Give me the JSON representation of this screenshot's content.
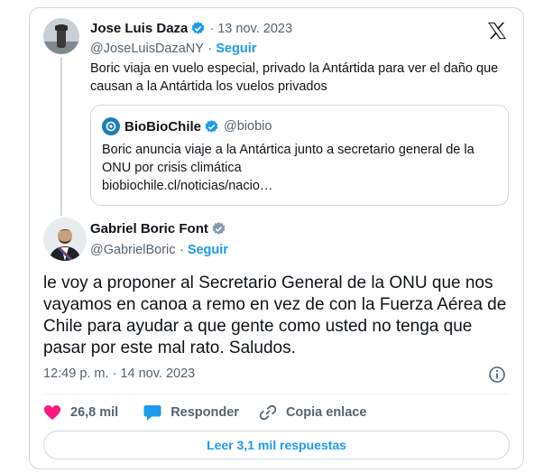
{
  "quoted_tweet": {
    "author_name": "Jose Luis Daza",
    "handle": "@JoseLuisDazaNY",
    "date": "13 nov. 2023",
    "follow_label": "Seguir",
    "text": "Boric viaja en vuelo especial, privado la Antártida para ver el daño que causan a la Antártida los vuelos privados",
    "embedded": {
      "author_name": "BioBioChile",
      "handle": "@biobio",
      "text": "Boric anuncia viaje a la Antártica junto a secretario general de la ONU por crisis climática",
      "link": "biobiochile.cl/noticias/nacio…"
    }
  },
  "main_tweet": {
    "author_name": "Gabriel Boric Font",
    "handle": "@GabrielBoric",
    "follow_label": "Seguir",
    "text": "le voy a proponer al Secretario General de la ONU que nos vayamos en canoa a remo en vez de con la Fuerza Aérea de Chile para ayudar a que gente como usted no tenga que pasar por este mal rato. Saludos.",
    "timestamp": "12:49 p. m. · 14 nov. 2023"
  },
  "actions": {
    "likes": "26,8 mil",
    "reply_label": "Responder",
    "copy_link_label": "Copia enlace"
  },
  "read_replies_label": "Leer 3,1 mil respuestas",
  "colors": {
    "accent": "#1d9bf0",
    "like": "#f91880",
    "muted": "#536471",
    "border": "#cfd9de",
    "verified_blue": "#1d9bf0",
    "verified_gray": "#829aab"
  },
  "icons": {
    "brand": "x-logo-icon",
    "verified": "verified-badge-icon",
    "info": "info-icon",
    "like": "heart-icon",
    "reply": "speech-bubble-icon",
    "copy_link": "link-icon"
  }
}
